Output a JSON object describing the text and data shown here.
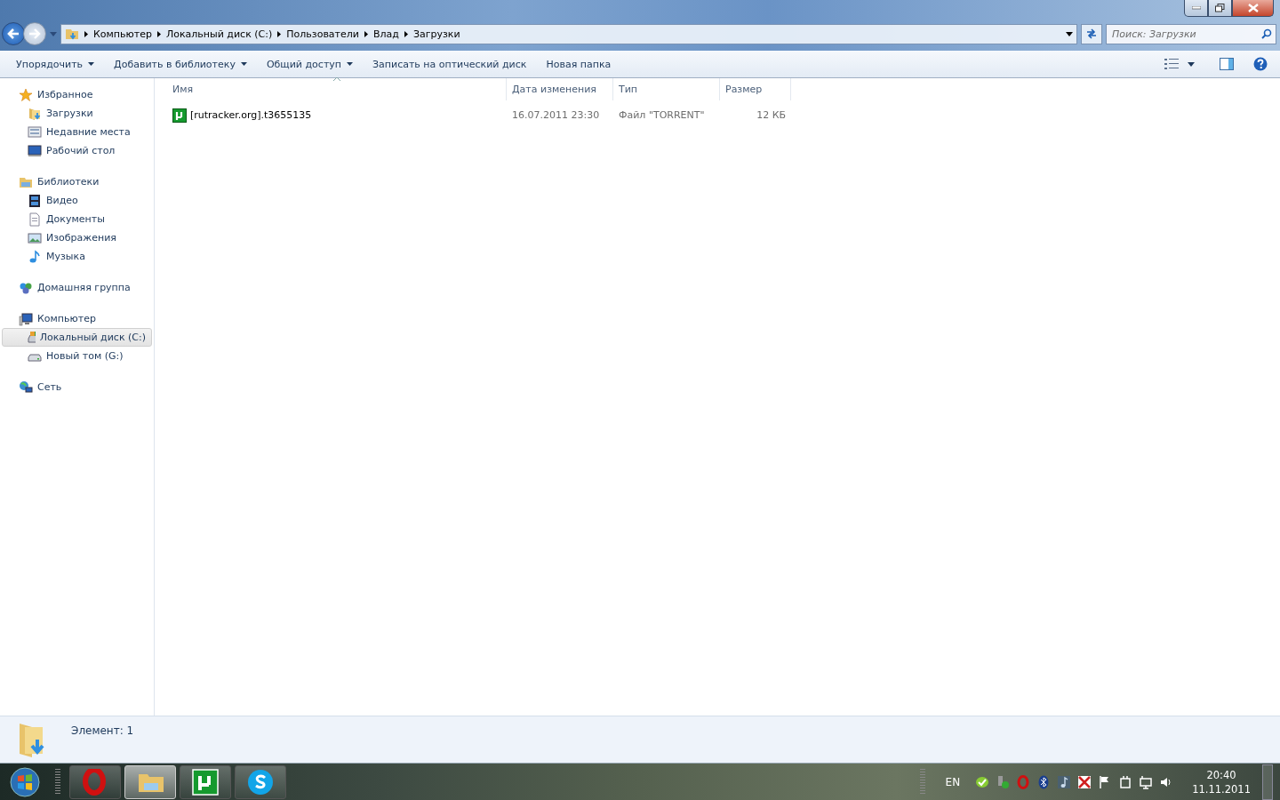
{
  "address_bar": {
    "crumbs": [
      "Компьютер",
      "Локальный диск (C:)",
      "Пользователи",
      "Влад",
      "Загрузки"
    ]
  },
  "search": {
    "placeholder": "Поиск: Загрузки"
  },
  "toolbar": {
    "items": [
      {
        "label": "Упорядочить",
        "dropdown": true
      },
      {
        "label": "Добавить в библиотеку",
        "dropdown": true
      },
      {
        "label": "Общий доступ",
        "dropdown": true
      },
      {
        "label": "Записать на оптический диск",
        "dropdown": false
      },
      {
        "label": "Новая папка",
        "dropdown": false
      }
    ]
  },
  "sidebar": {
    "groups": [
      {
        "label": "Избранное",
        "selected": false,
        "children": [
          {
            "label": "Загрузки",
            "selected": false
          },
          {
            "label": "Недавние места",
            "selected": false
          },
          {
            "label": "Рабочий стол",
            "selected": false
          }
        ]
      },
      {
        "label": "Библиотеки",
        "selected": false,
        "children": [
          {
            "label": "Видео",
            "selected": false
          },
          {
            "label": "Документы",
            "selected": false
          },
          {
            "label": "Изображения",
            "selected": false
          },
          {
            "label": "Музыка",
            "selected": false
          }
        ]
      },
      {
        "label": "Домашняя группа",
        "selected": false
      },
      {
        "label": "Компьютер",
        "selected": false,
        "children": [
          {
            "label": "Локальный диск (C:)",
            "selected": true
          },
          {
            "label": "Новый том (G:)",
            "selected": false
          }
        ]
      },
      {
        "label": "Сеть",
        "selected": false
      }
    ]
  },
  "table": {
    "columns": [
      {
        "label": "Имя",
        "sorted": true
      },
      {
        "label": "Дата изменения",
        "sorted": false
      },
      {
        "label": "Тип",
        "sorted": false
      },
      {
        "label": "Размер",
        "sorted": false
      }
    ],
    "rows": [
      {
        "name": "[rutracker.org].t3655135",
        "date": "16.07.2011 23:30",
        "type": "Файл \"TORRENT\"",
        "size": "12 КБ",
        "selected": false
      }
    ]
  },
  "details_pane": {
    "text": "Элемент: 1"
  },
  "taskbar": {
    "buttons": [
      {
        "selected": false
      },
      {
        "selected": true
      },
      {
        "selected": false
      },
      {
        "selected": false
      }
    ],
    "language": "EN",
    "time": "20:40",
    "date": "11.11.2011"
  }
}
